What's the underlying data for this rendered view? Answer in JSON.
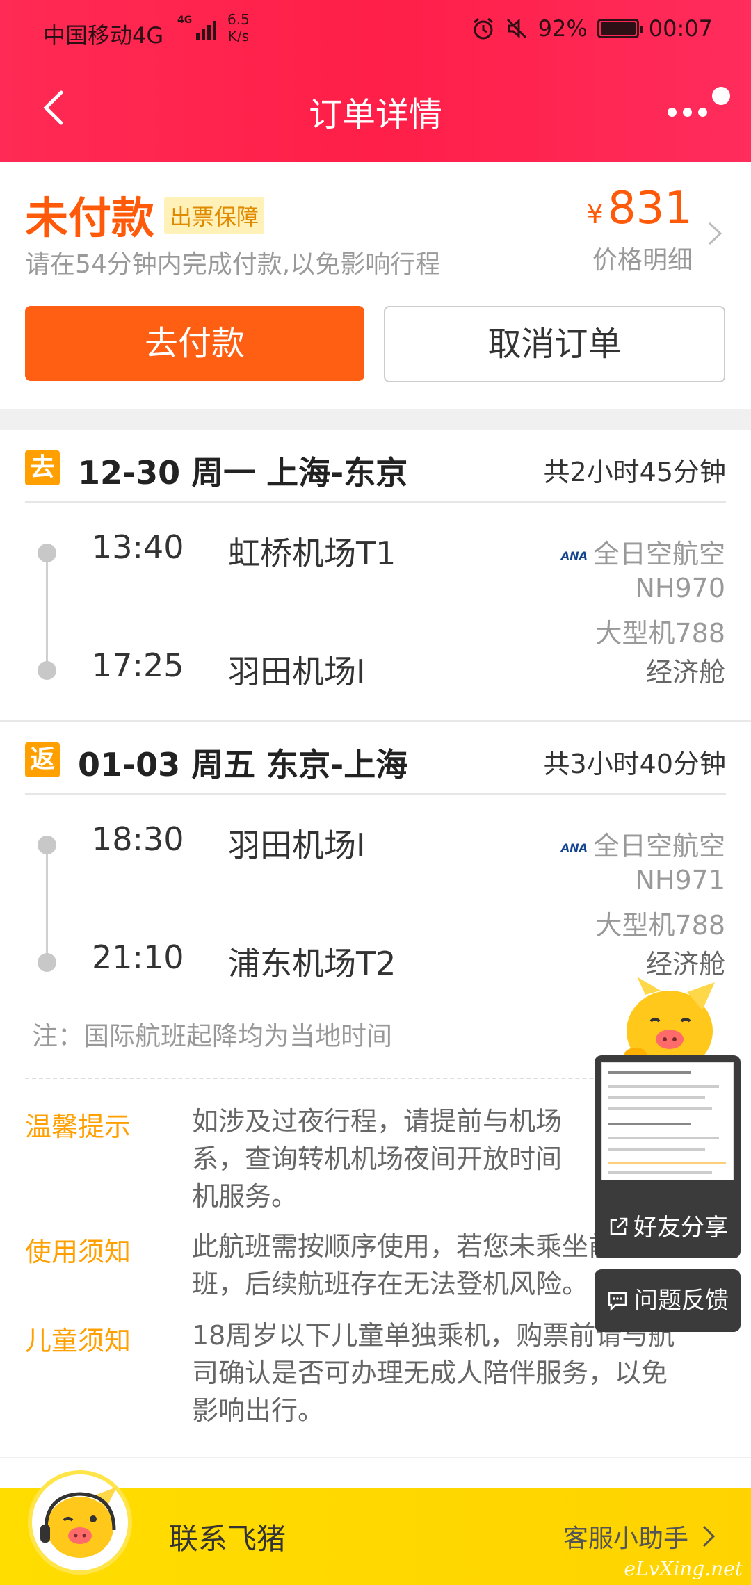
{
  "status_bar": {
    "carrier": "中国移动4G",
    "network_tag": "4G",
    "speed": "6.5",
    "speed_unit": "K/s",
    "battery": "92%",
    "battery_level": 0.92,
    "time": "00:07",
    "icons": [
      "alarm-icon",
      "mute-icon",
      "battery-icon"
    ]
  },
  "nav": {
    "title": "订单详情",
    "back_icon": "chevron-left-icon",
    "more_icon": "more-icon"
  },
  "order": {
    "status": "未付款",
    "guarantee_badge": "出票保障",
    "payment_tip": "请在54分钟内完成付款,以免影响行程",
    "currency": "¥",
    "price": "831",
    "price_detail_label": "价格明细",
    "pay_button": "去付款",
    "cancel_button": "取消订单"
  },
  "segments": [
    {
      "badge": "去",
      "title": "12-30 周一 上海-东京",
      "duration": "共2小时45分钟",
      "depart_time": "13:40",
      "depart_airport": "虹桥机场T1",
      "arrive_time": "17:25",
      "arrive_airport": "羽田机场I",
      "airline_logo": "ANA",
      "airline": "全日空航空",
      "flight_no": "NH970",
      "aircraft": "大型机788",
      "cabin": "经济舱"
    },
    {
      "badge": "返",
      "title": "01-03 周五 东京-上海",
      "duration": "共3小时40分钟",
      "depart_time": "18:30",
      "depart_airport": "羽田机场I",
      "arrive_time": "21:10",
      "arrive_airport": "浦东机场T2",
      "airline_logo": "ANA",
      "airline": "全日空航空",
      "flight_no": "NH971",
      "aircraft": "大型机788",
      "cabin": "经济舱"
    }
  ],
  "note": "注：国际航班起降均为当地时间",
  "tips": [
    {
      "label": "温馨提示",
      "lines": [
        "如涉及过夜行程，请提前与机场",
        "系，查询转机机场夜间开放时间",
        "机服务。"
      ]
    },
    {
      "label": "使用须知",
      "lines": [
        "此航班需按顺序使用，若您未乘坐前段航",
        "班，后续航班存在无法登机风险。"
      ]
    },
    {
      "label": "儿童须知",
      "lines": [
        "18周岁以下儿童单独乘机，购票前请与航",
        "司确认是否可办理无成人陪伴服务，以免",
        "影响出行。"
      ]
    }
  ],
  "floating": {
    "share_label": "好友分享",
    "feedback_label": "问题反馈"
  },
  "contact": {
    "label": "联系飞猪",
    "assistant": "客服小助手",
    "watermark": "eLvXing.net"
  }
}
